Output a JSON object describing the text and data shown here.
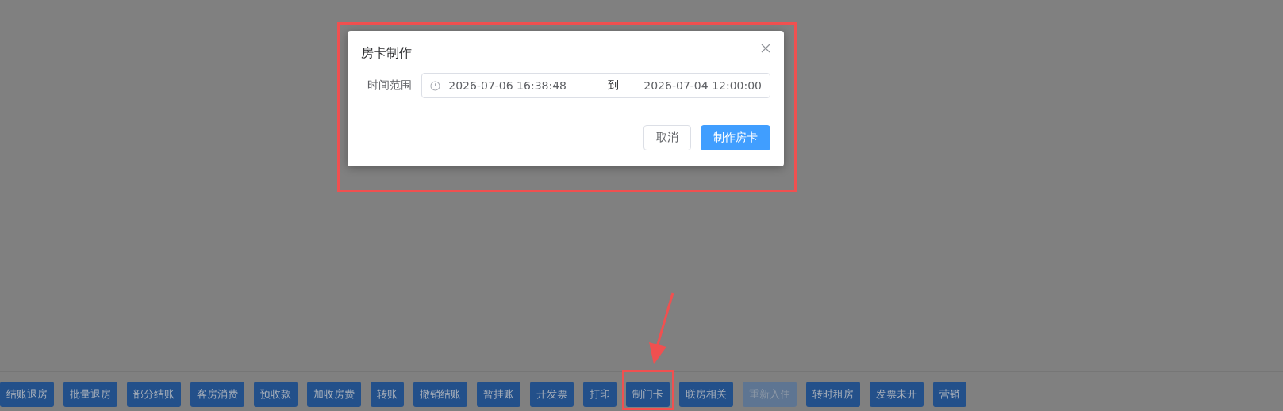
{
  "dialog": {
    "title": "房卡制作",
    "highlighted": true,
    "field": {
      "label": "时间范围",
      "start": "2026-07-06 16:38:48",
      "separator": "到",
      "end": "2026-07-04 12:00:00"
    },
    "buttons": [
      {
        "label": "取消",
        "kind": "default"
      },
      {
        "label": "制作房卡",
        "kind": "primary"
      }
    ]
  },
  "toolbar": [
    {
      "label": "结账退房",
      "disabled": false,
      "highlighted": false
    },
    {
      "label": "批量退房",
      "disabled": false,
      "highlighted": false
    },
    {
      "label": "部分结账",
      "disabled": false,
      "highlighted": false
    },
    {
      "label": "客房消费",
      "disabled": false,
      "highlighted": false
    },
    {
      "label": "预收款",
      "disabled": false,
      "highlighted": false
    },
    {
      "label": "加收房费",
      "disabled": false,
      "highlighted": false
    },
    {
      "label": "转账",
      "disabled": false,
      "highlighted": false
    },
    {
      "label": "撤销结账",
      "disabled": false,
      "highlighted": false
    },
    {
      "label": "暂挂账",
      "disabled": false,
      "highlighted": false
    },
    {
      "label": "开发票",
      "disabled": false,
      "highlighted": false
    },
    {
      "label": "打印",
      "disabled": false,
      "highlighted": false
    },
    {
      "label": "制门卡",
      "disabled": false,
      "highlighted": true
    },
    {
      "label": "联房相关",
      "disabled": false,
      "highlighted": false
    },
    {
      "label": "重新入住",
      "disabled": true,
      "highlighted": false
    },
    {
      "label": "转时租房",
      "disabled": false,
      "highlighted": false
    },
    {
      "label": "发票未开",
      "disabled": false,
      "highlighted": false
    },
    {
      "label": "营销",
      "disabled": false,
      "highlighted": false
    }
  ]
}
